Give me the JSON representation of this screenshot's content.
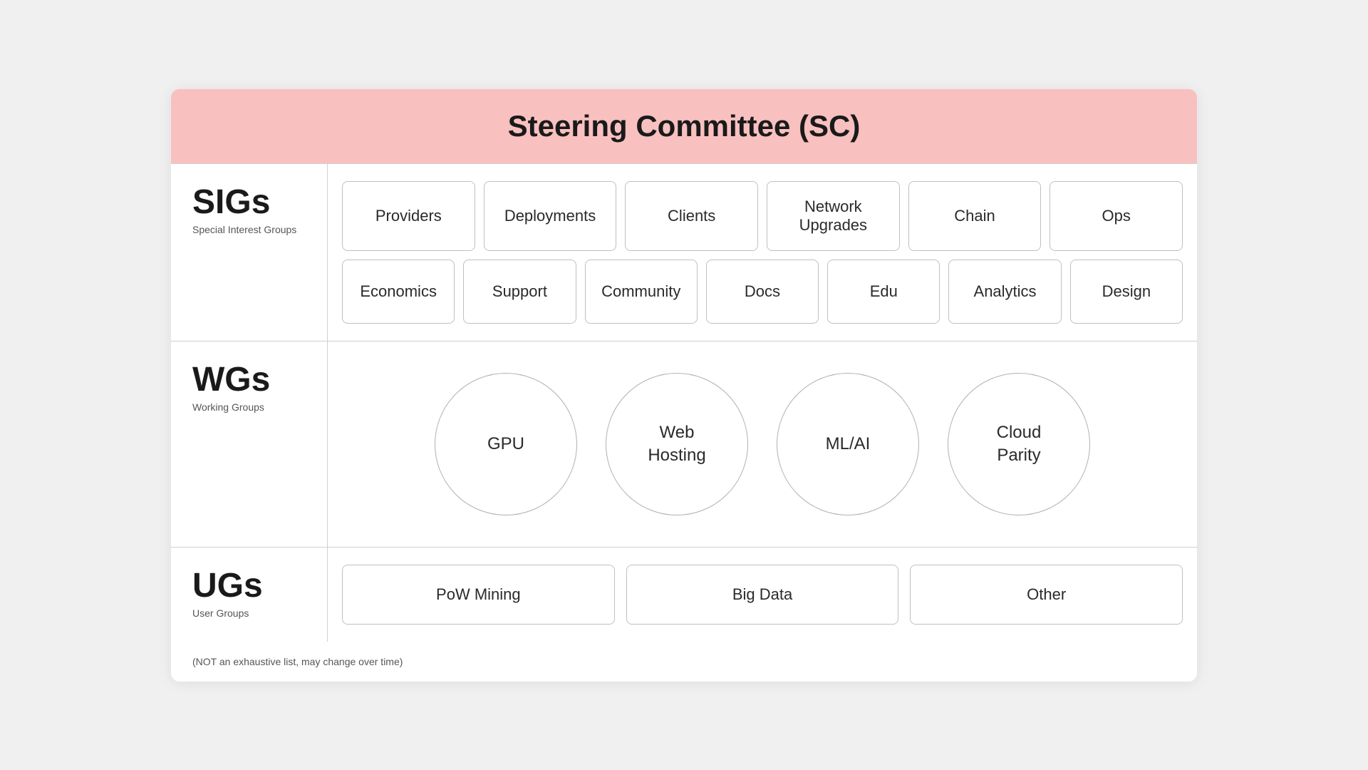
{
  "header": {
    "title": "Steering Committee (SC)"
  },
  "sigs": {
    "big_label": "SIGs",
    "sub_label": "Special Interest Groups",
    "row1": [
      "Providers",
      "Deployments",
      "Clients",
      "Network Upgrades",
      "Chain",
      "Ops"
    ],
    "row2": [
      "Economics",
      "Support",
      "Community",
      "Docs",
      "Edu",
      "Analytics",
      "Design"
    ]
  },
  "wgs": {
    "big_label": "WGs",
    "sub_label": "Working Groups",
    "items": [
      "GPU",
      "Web Hosting",
      "ML/AI",
      "Cloud Parity"
    ]
  },
  "ugs": {
    "big_label": "UGs",
    "sub_label": "User Groups",
    "items": [
      "PoW Mining",
      "Big Data",
      "Other"
    ]
  },
  "footnote": "(NOT an exhaustive list, may change over time)"
}
